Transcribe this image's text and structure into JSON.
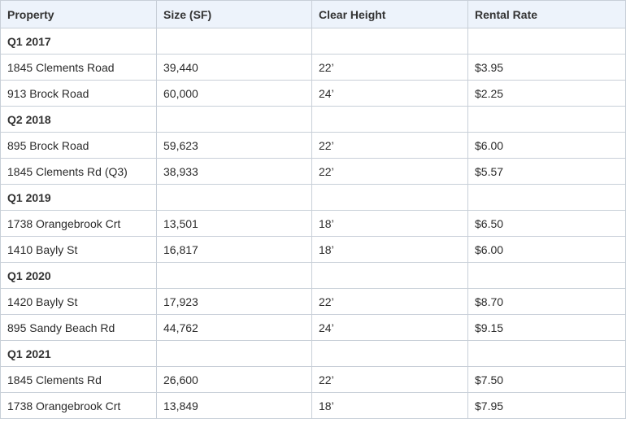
{
  "table": {
    "headers": [
      "Property",
      "Size (SF)",
      "Clear Height",
      "Rental Rate"
    ],
    "rows": [
      {
        "type": "period",
        "label": "Q1 2017"
      },
      {
        "type": "data",
        "property": "1845 Clements Road",
        "size": "39,440",
        "clear_height": "22’",
        "rental_rate": "$3.95"
      },
      {
        "type": "data",
        "property": "913 Brock Road",
        "size": "60,000",
        "clear_height": "24’",
        "rental_rate": "$2.25"
      },
      {
        "type": "period",
        "label": "Q2 2018"
      },
      {
        "type": "data",
        "property": "895 Brock Road",
        "size": "59,623",
        "clear_height": "22’",
        "rental_rate": "$6.00"
      },
      {
        "type": "data",
        "property": "1845 Clements Rd (Q3)",
        "size": "38,933",
        "clear_height": "22’",
        "rental_rate": "$5.57"
      },
      {
        "type": "period",
        "label": "Q1 2019"
      },
      {
        "type": "data",
        "property": "1738 Orangebrook Crt",
        "size": "13,501",
        "clear_height": "18’",
        "rental_rate": "$6.50"
      },
      {
        "type": "data",
        "property": "1410 Bayly St",
        "size": "16,817",
        "clear_height": "18’",
        "rental_rate": "$6.00"
      },
      {
        "type": "period",
        "label": "Q1 2020"
      },
      {
        "type": "data",
        "property": "1420 Bayly St",
        "size": "17,923",
        "clear_height": "22’",
        "rental_rate": "$8.70"
      },
      {
        "type": "data",
        "property": "895 Sandy Beach Rd",
        "size": "44,762",
        "clear_height": "24’",
        "rental_rate": "$9.15"
      },
      {
        "type": "period",
        "label": "Q1 2021"
      },
      {
        "type": "data",
        "property": "1845 Clements Rd",
        "size": "26,600",
        "clear_height": "22’",
        "rental_rate": "$7.50"
      },
      {
        "type": "data",
        "property": "1738 Orangebrook Crt",
        "size": "13,849",
        "clear_height": "18’",
        "rental_rate": "$7.95"
      }
    ]
  }
}
